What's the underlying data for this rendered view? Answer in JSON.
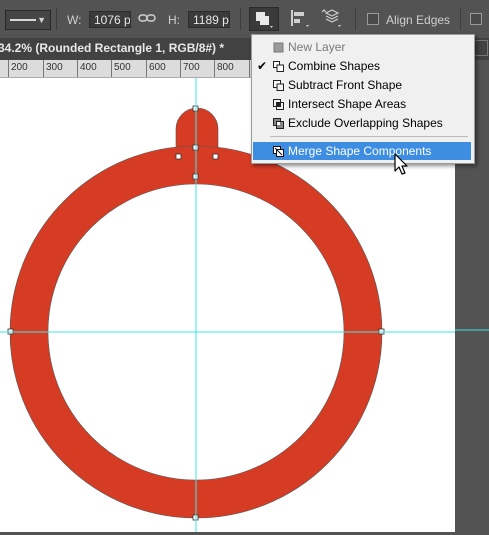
{
  "options_bar": {
    "w_label": "W:",
    "w_value": "1076 p",
    "h_label": "H:",
    "h_value": "1189 p",
    "align_edges_label": "Align Edges"
  },
  "document": {
    "tab_title": "34.2% (Rounded Rectangle 1, RGB/8#) *"
  },
  "ruler": {
    "labels": [
      "200",
      "300",
      "400",
      "500",
      "600",
      "700",
      "800"
    ]
  },
  "menu": {
    "items": [
      {
        "label": "New Layer",
        "disabled": true,
        "checked": false
      },
      {
        "label": "Combine Shapes",
        "disabled": false,
        "checked": true
      },
      {
        "label": "Subtract Front Shape",
        "disabled": false,
        "checked": false
      },
      {
        "label": "Intersect Shape Areas",
        "disabled": false,
        "checked": false
      },
      {
        "label": "Exclude Overlapping Shapes",
        "disabled": false,
        "checked": false
      },
      {
        "label": "Merge Shape Components",
        "disabled": false,
        "checked": false,
        "highlighted": true
      }
    ]
  },
  "colors": {
    "shape_fill": "#d63c24",
    "guide": "#3ee6e6",
    "highlight": "#3d8ee3"
  }
}
